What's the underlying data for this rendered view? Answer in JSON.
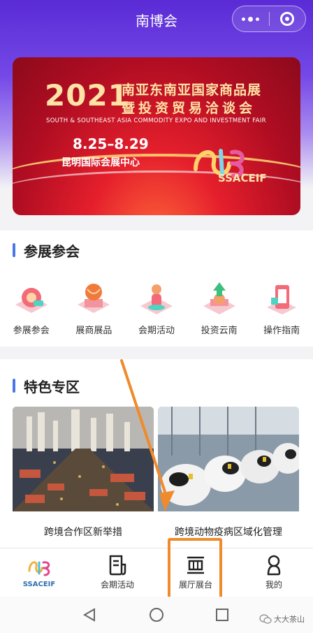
{
  "app": {
    "title": "南博会"
  },
  "banner": {
    "year": "2021",
    "name_line1": "南亚东南亚国家商品展",
    "name_line2": "暨投资贸易洽谈会",
    "english": "SOUTH & SOUTHEAST ASIA COMMODITY EXPO AND INVESTMENT FAIR",
    "dates": "8.25–8.29",
    "venue": "昆明国际会展中心",
    "logo_text": "SSACEIF"
  },
  "section1": {
    "title": "参展参会",
    "items": [
      {
        "label": "参展参会",
        "icon": "exhibit-register-icon"
      },
      {
        "label": "展商展品",
        "icon": "exhibitor-products-icon"
      },
      {
        "label": "会期活动",
        "icon": "events-icon"
      },
      {
        "label": "投资云南",
        "icon": "invest-yunnan-icon"
      },
      {
        "label": "操作指南",
        "icon": "guide-icon"
      }
    ]
  },
  "section2": {
    "title": "特色专区",
    "cards": [
      {
        "caption": "跨境合作区新举措"
      },
      {
        "caption": "跨境动物疫病区域化管理"
      }
    ]
  },
  "tabbar": {
    "logo_text": "SSACEIF",
    "items": [
      {
        "label": "会期活动"
      },
      {
        "label": "展厅展台"
      },
      {
        "label": "我的"
      }
    ]
  },
  "watermark": "大大茶山",
  "colors": {
    "accent": "#4a77e8",
    "highlight": "#f08a2c",
    "header": "#5a2bd6"
  }
}
